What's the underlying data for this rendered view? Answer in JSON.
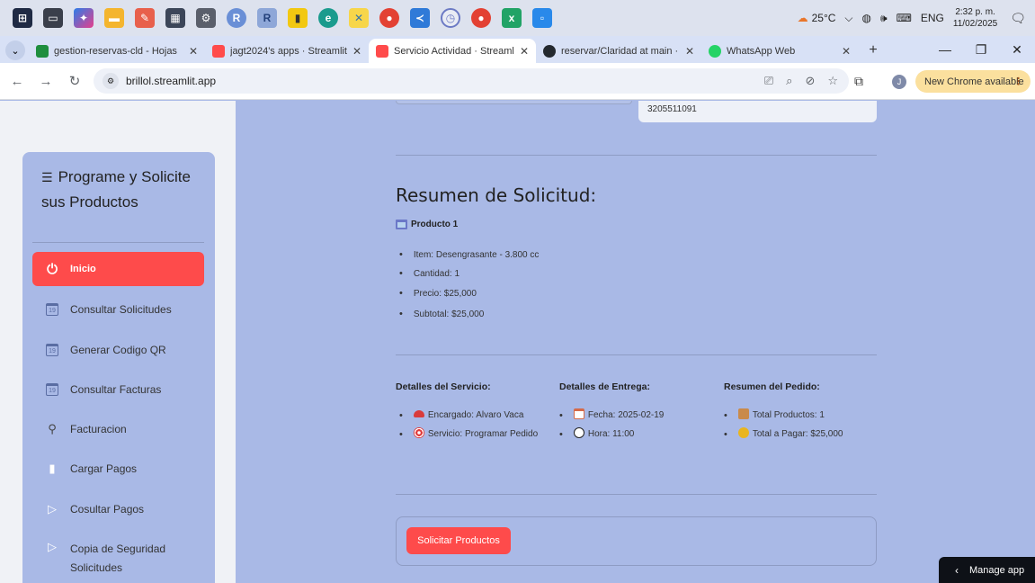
{
  "taskbar": {
    "icons": [
      "windows-start-icon",
      "task-view-icon",
      "copilot-icon",
      "file-explorer-icon",
      "paint-icon",
      "calculator-icon",
      "settings-icon",
      "r-icon",
      "rstudio-icon",
      "power-bi-icon",
      "edge-icon",
      "python-icon",
      "chrome-icon",
      "vscode-icon",
      "clock-app-icon",
      "chrome-profile-icon",
      "excel-icon",
      "azure-icon"
    ],
    "weather": "25°C",
    "language": "ENG",
    "time": "2:32 p. m.",
    "date": "11/02/2025"
  },
  "tabs": [
    {
      "title": "gestion-reservas-cld - Hojas",
      "color": "#1e8e3e"
    },
    {
      "title": "jagt2024's apps · Streamlit",
      "color": "#ff4b4b"
    },
    {
      "title": "Servicio Actividad · Streamlit",
      "color": "#ff4b4b",
      "active": true
    },
    {
      "title": "reservar/Claridad at main · ja",
      "color": "#24292f"
    },
    {
      "title": "WhatsApp Web",
      "color": "#25d366"
    }
  ],
  "address": {
    "url": "brillol.streamlit.app",
    "profile_initial": "J",
    "update_label": "New Chrome available"
  },
  "sidebar": {
    "title": "Programe y Solicite sus Productos",
    "items": [
      {
        "label": "Inicio",
        "icon": "power-icon",
        "active": true
      },
      {
        "label": "Consultar Solicitudes",
        "icon": "calendar-icon"
      },
      {
        "label": "Generar Codigo QR",
        "icon": "calendar-icon"
      },
      {
        "label": "Consultar Facturas",
        "icon": "calendar-icon"
      },
      {
        "label": "Facturacion",
        "icon": "person-icon"
      },
      {
        "label": "Cargar Pagos",
        "icon": "clipboard-icon"
      },
      {
        "label": "Cosultar Pagos",
        "icon": "play-icon"
      },
      {
        "label": "Copia de Seguridad Solicitudes",
        "icon": "play-icon"
      }
    ]
  },
  "main": {
    "phone": "3205511091",
    "summary_title": "Resumen de Solicitud:",
    "product_label": "Producto 1",
    "product_items": [
      "Item: Desengrasante - 3.800 cc",
      "Cantidad: 1",
      "Precio: $25,000",
      "Subtotal: $25,000"
    ],
    "service": {
      "title": "Detalles del Servicio:",
      "encargado": "Encargado: Alvaro Vaca",
      "servicio": "Servicio: Programar Pedido"
    },
    "delivery": {
      "title": "Detalles de Entrega:",
      "fecha": "Fecha: 2025-02-19",
      "hora": "Hora: 11:00"
    },
    "order": {
      "title": "Resumen del Pedido:",
      "total_productos": "Total Productos: 1",
      "total_pagar": "Total a Pagar: $25,000"
    },
    "submit_label": "Solicitar Productos",
    "manage_label": "Manage app"
  }
}
